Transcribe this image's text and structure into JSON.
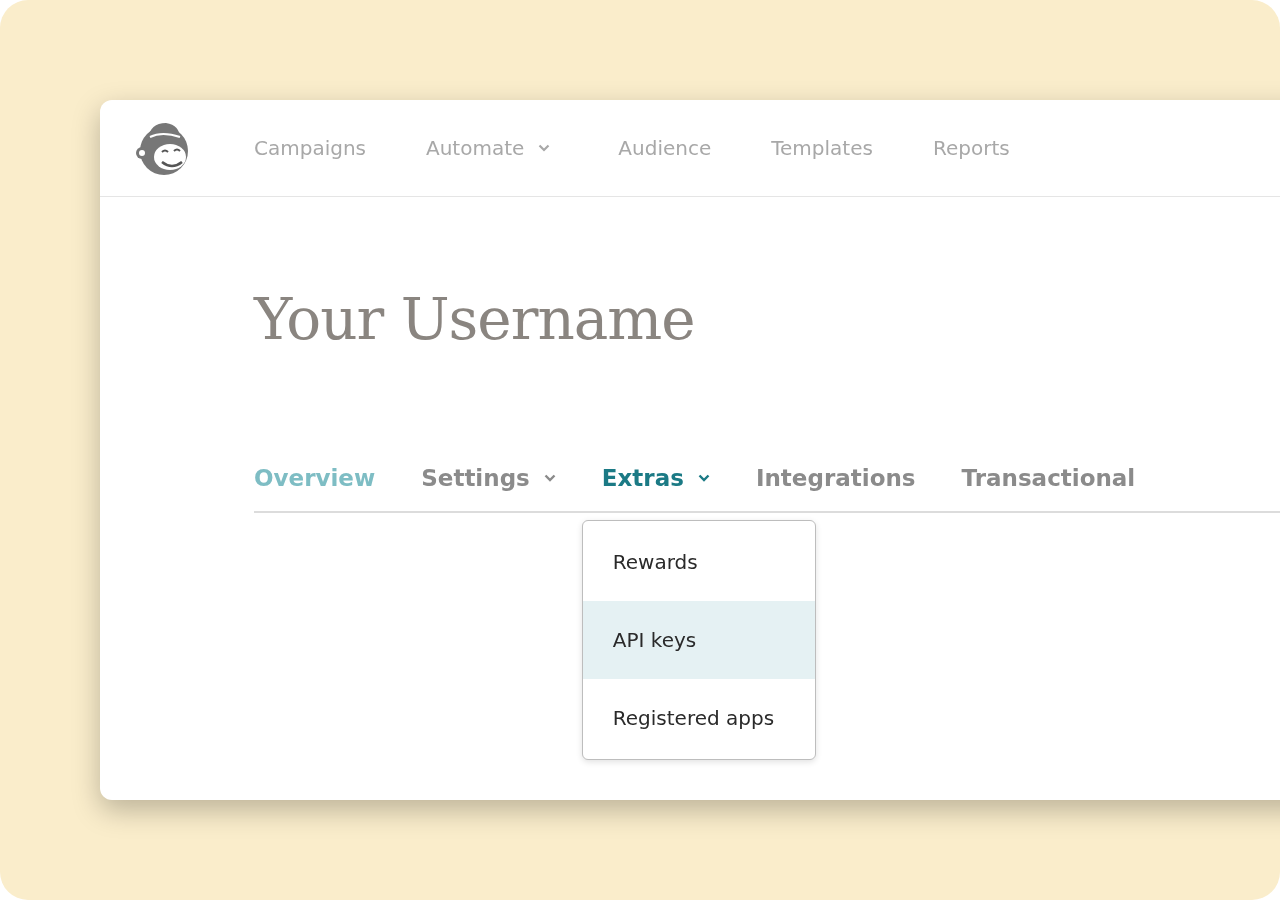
{
  "top_nav": [
    {
      "label": "Campaigns",
      "has_caret": false
    },
    {
      "label": "Automate",
      "has_caret": true
    },
    {
      "label": "Audience",
      "has_caret": false
    },
    {
      "label": "Templates",
      "has_caret": false
    },
    {
      "label": "Reports",
      "has_caret": false
    }
  ],
  "page_title": "Your Username",
  "tabs": [
    {
      "label": "Overview",
      "has_caret": false,
      "selected": false,
      "hovered": true
    },
    {
      "label": "Settings",
      "has_caret": true,
      "selected": false,
      "hovered": false
    },
    {
      "label": "Extras",
      "has_caret": true,
      "selected": true,
      "hovered": false
    },
    {
      "label": "Integrations",
      "has_caret": false,
      "selected": false,
      "hovered": false
    },
    {
      "label": "Transactional",
      "has_caret": false,
      "selected": false,
      "hovered": false
    }
  ],
  "dropdown": {
    "items": [
      {
        "label": "Rewards",
        "selected": false
      },
      {
        "label": "API keys",
        "selected": true
      },
      {
        "label": "Registered apps",
        "selected": false
      }
    ]
  }
}
